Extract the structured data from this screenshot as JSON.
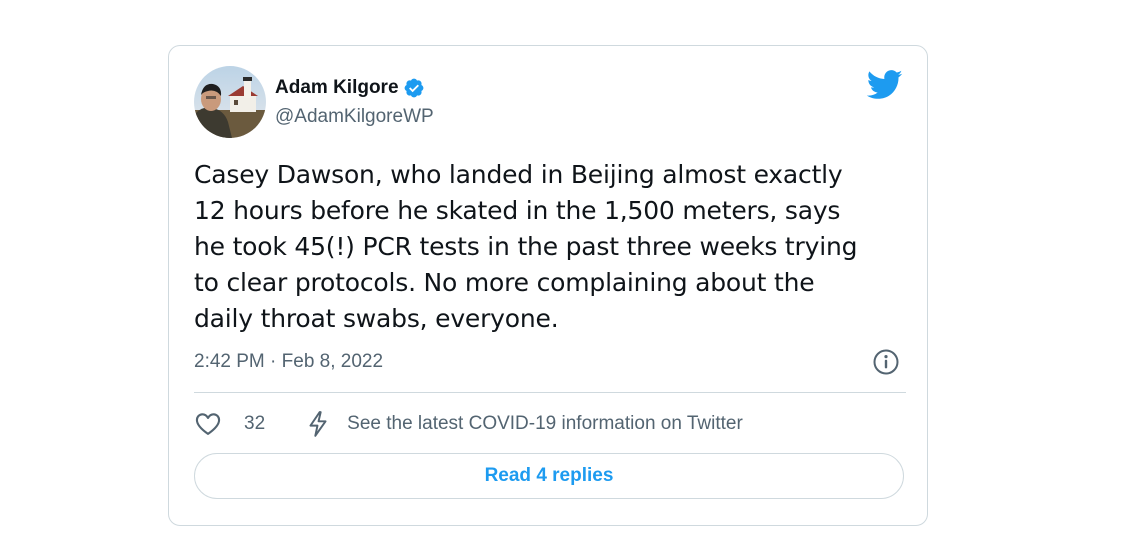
{
  "tweet": {
    "author": {
      "name": "Adam Kilgore",
      "handle": "@AdamKilgoreWP",
      "verified": true
    },
    "text": "Casey Dawson, who landed in Beijing almost exactly\n12 hours before he skated in the 1,500 meters, says\nhe took 45(!) PCR tests in the past three weeks trying\nto clear protocols. No more complaining about the\ndaily throat swabs, everyone.",
    "timestamp": "2:42 PM · Feb 8, 2022",
    "likes": "32",
    "covid_notice": "See the latest COVID-19 information on Twitter",
    "replies_label": "Read 4 replies"
  },
  "icons": {
    "logo": "twitter-bird-icon",
    "verified": "verified-badge-icon",
    "info": "info-icon",
    "like": "heart-icon",
    "covid": "lightning-bolt-icon"
  },
  "colors": {
    "accent": "#1d9bf0",
    "text": "#0f1419",
    "secondary": "#536471",
    "border": "#cfd9de"
  }
}
